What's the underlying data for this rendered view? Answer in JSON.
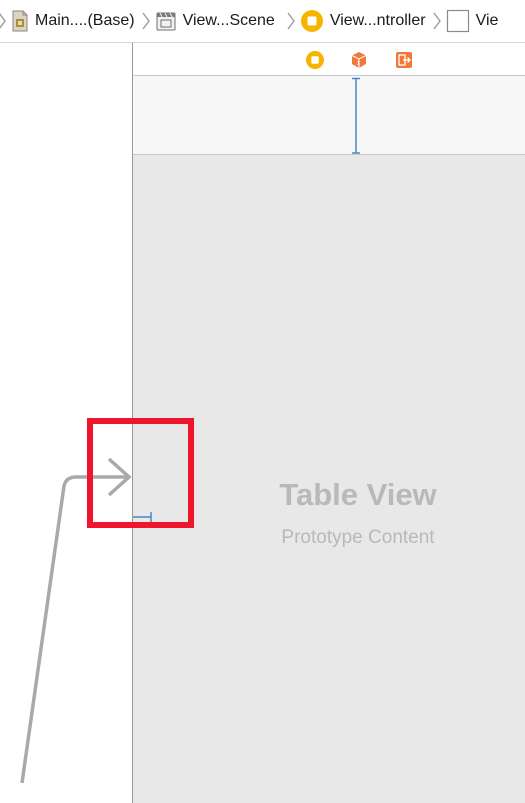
{
  "breadcrumb": {
    "items": [
      {
        "label": "Main....(Base)",
        "icon": "storyboard-file-icon"
      },
      {
        "label": "View...Scene",
        "icon": "scene-icon"
      },
      {
        "label": "View...ntroller",
        "icon": "view-controller-icon"
      },
      {
        "label": "Vie",
        "icon": "view-icon"
      }
    ]
  },
  "table_view": {
    "title": "Table View",
    "subtitle": "Prototype Content"
  },
  "dock": {
    "icons": [
      "view-controller-icon",
      "first-responder-icon",
      "exit-icon"
    ]
  },
  "colors": {
    "highlight": "#f0142c",
    "constraint": "#4a86c8",
    "vc_yellow": "#f5b400",
    "dock_orange": "#f07838",
    "table_bg": "#e8e8e8"
  }
}
